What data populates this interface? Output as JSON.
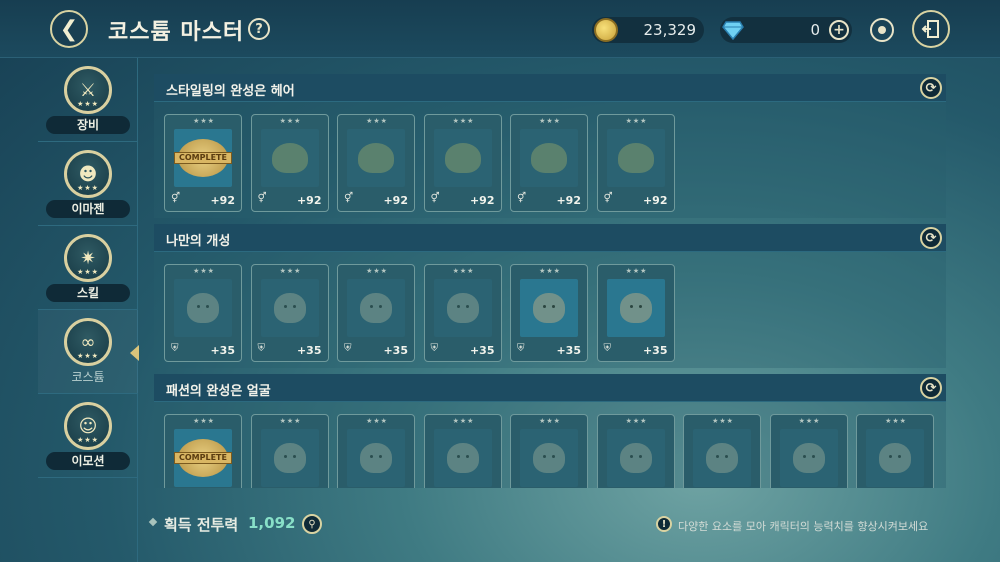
{
  "header": {
    "title": "코스튬 마스터",
    "help_label": "?",
    "gold": "23,329",
    "gems": "0",
    "plus_label": "+"
  },
  "sidebar": {
    "items": [
      {
        "label": "장비",
        "icon": "crossed-swords-icon",
        "glyph": "⚔",
        "stars": "★★★"
      },
      {
        "label": "이마젠",
        "icon": "imagen-creature-icon",
        "glyph": "☻",
        "stars": "★★★"
      },
      {
        "label": "스킬",
        "icon": "skill-burst-icon",
        "glyph": "✷",
        "stars": "★★★"
      },
      {
        "label": "코스튬",
        "icon": "mask-icon",
        "glyph": "∞",
        "stars": "★★★",
        "active": true
      },
      {
        "label": "이모션",
        "icon": "smile-icon",
        "glyph": "☺",
        "stars": "★★★"
      }
    ]
  },
  "sections": [
    {
      "title": "스타일링의 완성은 헤어",
      "refresh_label": "⟳",
      "cards": [
        {
          "stars": "★★★",
          "type": "complete",
          "complete_text": "COMPLETE",
          "bonus": "+92",
          "stat_icon": "gender-stat-icon"
        },
        {
          "stars": "★★★",
          "type": "hair",
          "bonus": "+92",
          "stat_icon": "gender-stat-icon"
        },
        {
          "stars": "★★★",
          "type": "hair",
          "bonus": "+92",
          "stat_icon": "gender-stat-icon"
        },
        {
          "stars": "★★★",
          "type": "hair",
          "bonus": "+92",
          "stat_icon": "gender-stat-icon"
        },
        {
          "stars": "★★★",
          "type": "hair",
          "bonus": "+92",
          "stat_icon": "gender-stat-icon"
        },
        {
          "stars": "★★★",
          "type": "hair",
          "bonus": "+92",
          "stat_icon": "gender-stat-icon"
        }
      ]
    },
    {
      "title": "나만의 개성",
      "refresh_label": "⟳",
      "cards": [
        {
          "stars": "★★★",
          "type": "face",
          "bonus": "+35",
          "stat_icon": "shield-icon"
        },
        {
          "stars": "★★★",
          "type": "face",
          "bonus": "+35",
          "stat_icon": "shield-icon"
        },
        {
          "stars": "★★★",
          "type": "face",
          "bonus": "+35",
          "stat_icon": "shield-icon"
        },
        {
          "stars": "★★★",
          "type": "face",
          "bonus": "+35",
          "stat_icon": "shield-icon"
        },
        {
          "stars": "★★★",
          "type": "face-active",
          "bonus": "+35",
          "stat_icon": "shield-icon"
        },
        {
          "stars": "★★★",
          "type": "face-active",
          "bonus": "+35",
          "stat_icon": "shield-icon"
        }
      ]
    },
    {
      "title": "패션의 완성은 얼굴",
      "refresh_label": "⟳",
      "cards": [
        {
          "stars": "★★★",
          "type": "complete",
          "complete_text": "COMPLETE"
        },
        {
          "stars": "★★★",
          "type": "face"
        },
        {
          "stars": "★★★",
          "type": "face"
        },
        {
          "stars": "★★★",
          "type": "face"
        },
        {
          "stars": "★★★",
          "type": "face"
        },
        {
          "stars": "★★★",
          "type": "face"
        },
        {
          "stars": "★★★",
          "type": "face"
        },
        {
          "stars": "★★★",
          "type": "face"
        },
        {
          "stars": "★★★",
          "type": "face"
        }
      ]
    }
  ],
  "footer": {
    "power_label": "획득 전투력",
    "power_value": "1,092",
    "tip_text": "다양한 요소를 모아 캐릭터의 능력치를 향상시켜보세요"
  }
}
